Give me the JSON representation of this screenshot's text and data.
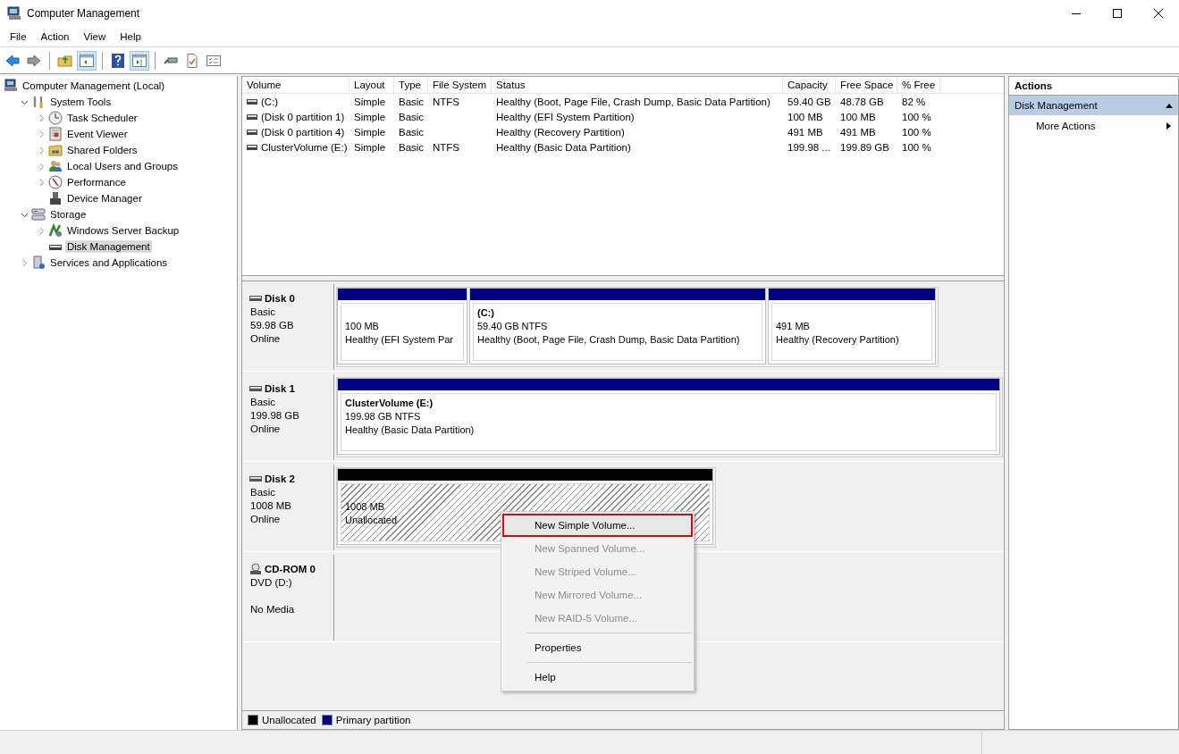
{
  "window": {
    "title": "Computer Management"
  },
  "menu": [
    "File",
    "Action",
    "View",
    "Help"
  ],
  "toolbar": [
    {
      "kind": "back",
      "pressed": false
    },
    {
      "kind": "forward",
      "pressed": false
    },
    {
      "kind": "up",
      "pressed": false
    },
    {
      "kind": "tree",
      "pressed": true
    },
    {
      "kind": "help",
      "pressed": false
    },
    {
      "kind": "pane",
      "pressed": true
    },
    {
      "kind": "connect",
      "pressed": false
    },
    {
      "kind": "check",
      "pressed": false
    },
    {
      "kind": "list",
      "pressed": false
    }
  ],
  "tree": [
    {
      "label": "Computer Management (Local)",
      "selected": false,
      "children": [
        {
          "label": "System Tools",
          "selected": false,
          "expanded": true,
          "children": [
            {
              "label": "Task Scheduler",
              "selected": false,
              "expanded": false
            },
            {
              "label": "Event Viewer",
              "selected": false,
              "expanded": false
            },
            {
              "label": "Shared Folders",
              "selected": false,
              "expanded": false
            },
            {
              "label": "Local Users and Groups",
              "selected": false,
              "expanded": false
            },
            {
              "label": "Performance",
              "selected": false,
              "expanded": false
            },
            {
              "label": "Device Manager",
              "selected": false
            }
          ]
        },
        {
          "label": "Storage",
          "selected": false,
          "expanded": true,
          "children": [
            {
              "label": "Windows Server Backup",
              "selected": false,
              "expanded": false
            },
            {
              "label": "Disk Management",
              "selected": true
            }
          ]
        },
        {
          "label": "Services and Applications",
          "selected": false,
          "expanded": false
        }
      ]
    }
  ],
  "volume_table": {
    "columns": [
      "Volume",
      "Layout",
      "Type",
      "File System",
      "Status",
      "Capacity",
      "Free Space",
      "% Free"
    ],
    "rows": [
      [
        "(C:)",
        "Simple",
        "Basic",
        "NTFS",
        "Healthy (Boot, Page File, Crash Dump, Basic Data Partition)",
        "59.40 GB",
        "48.78 GB",
        "82 %"
      ],
      [
        "(Disk 0 partition 1)",
        "Simple",
        "Basic",
        "",
        "Healthy (EFI System Partition)",
        "100 MB",
        "100 MB",
        "100 %"
      ],
      [
        "(Disk 0 partition 4)",
        "Simple",
        "Basic",
        "",
        "Healthy (Recovery Partition)",
        "491 MB",
        "491 MB",
        "100 %"
      ],
      [
        "ClusterVolume (E:)",
        "Simple",
        "Basic",
        "NTFS",
        "Healthy (Basic Data Partition)",
        "199.98 ...",
        "199.89 GB",
        "100 %"
      ]
    ]
  },
  "disks": [
    {
      "name": "Disk 0",
      "kind": "disk",
      "type": "Basic",
      "size": "59.98 GB",
      "status": "Online",
      "partitions": [
        {
          "kind": "primary",
          "size": "100 MB",
          "status": "Healthy (EFI System Par"
        },
        {
          "kind": "primary",
          "title": "(C:)",
          "size": "59.40 GB NTFS",
          "status": "Healthy (Boot, Page File, Crash Dump, Basic Data Partition)"
        },
        {
          "kind": "primary",
          "size": "491 MB",
          "status": "Healthy (Recovery Partition)"
        }
      ]
    },
    {
      "name": "Disk 1",
      "kind": "disk",
      "type": "Basic",
      "size": "199.98 GB",
      "status": "Online",
      "partitions": [
        {
          "kind": "primary",
          "title": "ClusterVolume  (E:)",
          "size": "199.98 GB NTFS",
          "status": "Healthy (Basic Data Partition)"
        }
      ]
    },
    {
      "name": "Disk 2",
      "kind": "disk",
      "type": "Basic",
      "size": "1008 MB",
      "status": "Online",
      "partitions": [
        {
          "kind": "unallocated",
          "size": "1008 MB",
          "status": "Unallocated"
        }
      ]
    },
    {
      "name": "CD-ROM 0",
      "kind": "cdrom",
      "type": "DVD (D:)",
      "status": "No Media"
    }
  ],
  "legend": [
    {
      "label": "Unallocated",
      "color": "#000000"
    },
    {
      "label": "Primary partition",
      "color": "#000080"
    }
  ],
  "context_menu": [
    {
      "label": "New Simple Volume...",
      "disabled": false,
      "selected": true
    },
    {
      "label": "New Spanned Volume...",
      "disabled": true,
      "selected": false
    },
    {
      "label": "New Striped Volume...",
      "disabled": true,
      "selected": false
    },
    {
      "label": "New Mirrored Volume...",
      "disabled": true,
      "selected": false
    },
    {
      "label": "New RAID-5 Volume...",
      "disabled": true,
      "selected": false
    },
    {
      "label": "Properties",
      "disabled": false,
      "selected": false,
      "separator_before": true
    },
    {
      "label": "Help",
      "disabled": false,
      "selected": false,
      "separator_before": true
    }
  ],
  "actions": {
    "header": "Actions",
    "section": {
      "label": "Disk Management",
      "expanded": true
    },
    "items": [
      "More Actions"
    ]
  }
}
